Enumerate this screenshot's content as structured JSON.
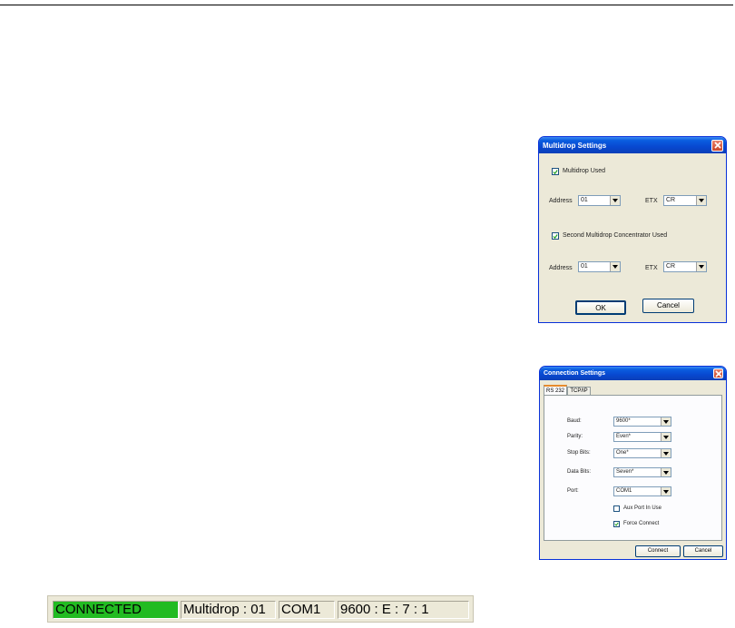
{
  "multidrop": {
    "title": "Multidrop Settings",
    "multidrop_used_label": "Multidrop Used",
    "multidrop_used_checked": true,
    "address_label": "Address",
    "address_value": "01",
    "etx_label": "ETX",
    "etx_value": "CR",
    "second_label": "Second Multidrop Concentrator Used",
    "second_checked": true,
    "address2_label": "Address",
    "address2_value": "01",
    "etx2_label": "ETX",
    "etx2_value": "CR",
    "ok_label": "OK",
    "cancel_label": "Cancel"
  },
  "connection": {
    "title": "Connection Settings",
    "tabs": [
      "RS 232",
      "TCP/IP"
    ],
    "active_tab": "RS 232",
    "baud_label": "Baud:",
    "baud_value": "9600*",
    "parity_label": "Parity:",
    "parity_value": "Even*",
    "stop_label": "Stop Bits:",
    "stop_value": "One*",
    "data_label": "Data Bits:",
    "data_value": "Seven*",
    "port_label": "Port:",
    "port_value": "COM1",
    "aux_label": "Aux Port In Use",
    "aux_checked": false,
    "force_label": "Force Connect",
    "force_checked": true,
    "connect_label": "Connect",
    "cancel_label": "Cancel"
  },
  "status": {
    "state": "CONNECTED",
    "state_color": "#22bb22",
    "multidrop": "Multidrop : 01",
    "port": "COM1",
    "params": "9600 : E : 7 : 1"
  }
}
